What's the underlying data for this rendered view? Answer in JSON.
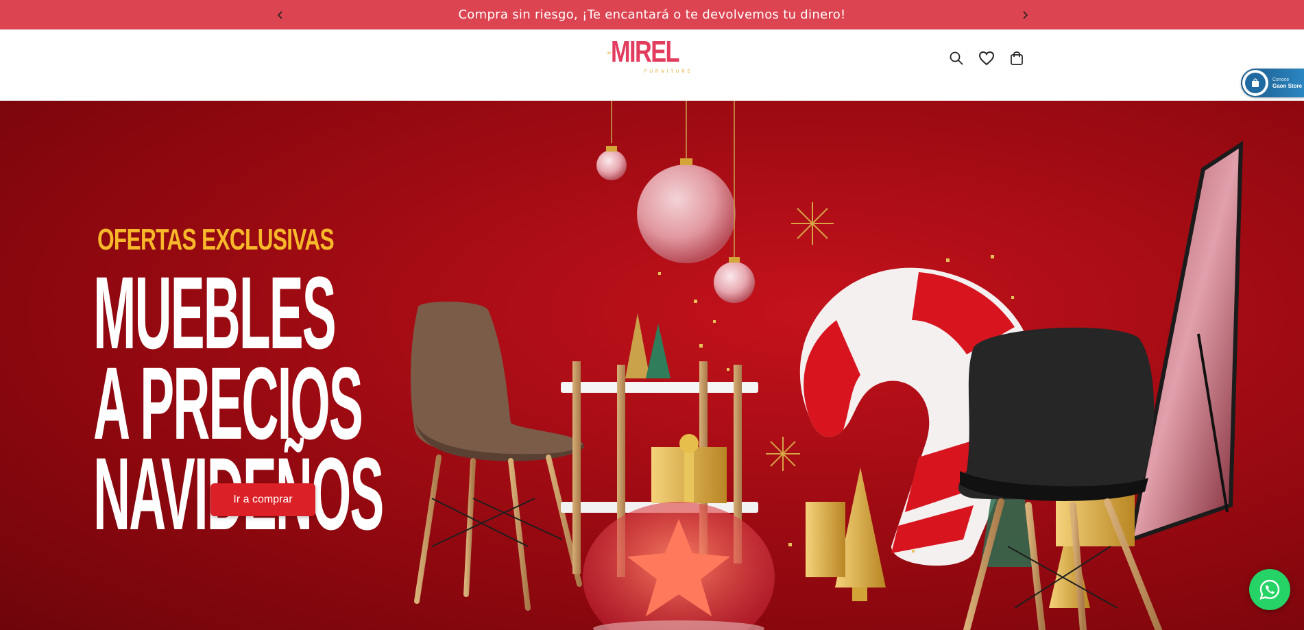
{
  "announcement": {
    "text": "Compra sin riesgo, ¡Te encantará o te devolvemos tu dinero!",
    "prev_icon": "chevron-left-icon",
    "next_icon": "chevron-right-icon"
  },
  "header": {
    "logo_brand": "MIREL",
    "logo_sub": "FURNITURE",
    "icons": [
      "search-icon",
      "heart-icon",
      "bag-icon"
    ]
  },
  "gaon_badge": {
    "line1": "Conoce",
    "line2": "Gaon Store"
  },
  "hero": {
    "eyebrow": "OFERTAS EXCLUSIVAS",
    "headline_line1": "MUEBLES",
    "headline_line2": "A PRECIOS",
    "headline_line3": "NAVIDEÑOS",
    "cta_label": "Ir a comprar"
  },
  "colors": {
    "announcement_bg": "#dd4451",
    "hero_bg": "#a60c14",
    "eyebrow": "#f7b82a",
    "cta_bg": "#dc2027",
    "whatsapp": "#25d366"
  }
}
